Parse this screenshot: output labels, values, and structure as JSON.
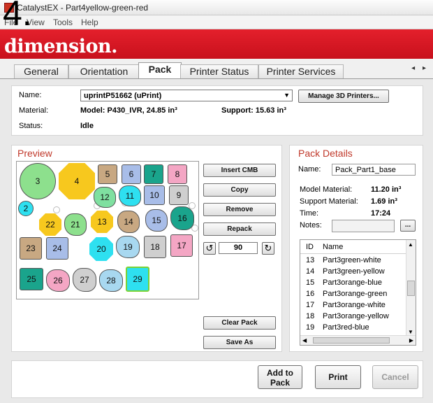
{
  "annotation": {
    "step": "4."
  },
  "window": {
    "title": "CatalystEX - Part4yellow-green-red"
  },
  "menu": [
    "File",
    "View",
    "Tools",
    "Help"
  ],
  "banner": {
    "logo": "dimension."
  },
  "tabs": [
    {
      "label": "General",
      "active": false
    },
    {
      "label": "Orientation",
      "active": false
    },
    {
      "label": "Pack",
      "active": true
    },
    {
      "label": "Printer Status",
      "active": false
    },
    {
      "label": "Printer Services",
      "active": false
    }
  ],
  "tab_arrows": "◂ ▸",
  "printer": {
    "name_label": "Name:",
    "name_value": "uprintP51662  (uPrint)",
    "manage_button": "Manage 3D Printers...",
    "material_label": "Material:",
    "material_value": "Model:  P430_IVR, 24.85 in³",
    "support_value": "Support:  15.63 in³",
    "status_label": "Status:",
    "status_value": "Idle"
  },
  "preview": {
    "title": "Preview",
    "buttons": {
      "insert": "Insert CMB",
      "copy": "Copy",
      "remove": "Remove",
      "repack": "Repack",
      "clear": "Clear Pack",
      "save": "Save As"
    },
    "rotate_ccw_icon": "↺",
    "rotate_cw_icon": "↻",
    "rotation_value": "90",
    "parts": [
      {
        "id": "3",
        "color": "#8de08d"
      },
      {
        "id": "4",
        "color": "#f7c81e"
      },
      {
        "id": "5",
        "color": "#c8a882"
      },
      {
        "id": "6",
        "color": "#a8bde8"
      },
      {
        "id": "7",
        "color": "#1aa48c"
      },
      {
        "id": "8",
        "color": "#f4a6c4"
      },
      {
        "id": "2",
        "color": "#2ee0f0"
      },
      {
        "id": "12",
        "color": "#7fe0a0"
      },
      {
        "id": "11",
        "color": "#2ee0f0"
      },
      {
        "id": "10",
        "color": "#a8bde8"
      },
      {
        "id": "9",
        "color": "#cfcfcf"
      },
      {
        "id": "22",
        "color": "#f7c81e"
      },
      {
        "id": "21",
        "color": "#8de08d"
      },
      {
        "id": "13",
        "color": "#f7c81e"
      },
      {
        "id": "14",
        "color": "#c8a882"
      },
      {
        "id": "15",
        "color": "#a8bde8"
      },
      {
        "id": "16",
        "color": "#1aa48c"
      },
      {
        "id": "23",
        "color": "#c8a882"
      },
      {
        "id": "24",
        "color": "#a8bde8"
      },
      {
        "id": "20",
        "color": "#2ee0f0"
      },
      {
        "id": "19",
        "color": "#a8d8f0"
      },
      {
        "id": "18",
        "color": "#cfcfcf"
      },
      {
        "id": "17",
        "color": "#f4a6c4"
      },
      {
        "id": "25",
        "color": "#1aa48c"
      },
      {
        "id": "26",
        "color": "#f4a6c4"
      },
      {
        "id": "27",
        "color": "#cfcfcf"
      },
      {
        "id": "28",
        "color": "#a8d8f0"
      },
      {
        "id": "29",
        "color": "#2ee0f0"
      }
    ]
  },
  "pack_details": {
    "title": "Pack Details",
    "name_label": "Name:",
    "name_value": "Pack_Part1_base",
    "model_material_label": "Model Material:",
    "model_material_value": "11.20 in³",
    "support_material_label": "Support Material:",
    "support_material_value": "1.69 in³",
    "time_label": "Time:",
    "time_value": "17:24",
    "notes_label": "Notes:",
    "notes_button": "...",
    "list_headers": {
      "id": "ID",
      "name": "Name"
    },
    "list_rows": [
      {
        "id": "13",
        "name": "Part3green-white"
      },
      {
        "id": "14",
        "name": "Part3green-yellow"
      },
      {
        "id": "15",
        "name": "Part3orange-blue"
      },
      {
        "id": "16",
        "name": "Part3orange-green"
      },
      {
        "id": "17",
        "name": "Part3orange-white"
      },
      {
        "id": "18",
        "name": "Part3orange-yellow"
      },
      {
        "id": "19",
        "name": "Part3red-blue"
      }
    ]
  },
  "actions": {
    "add_to_pack": "Add to Pack",
    "print": "Print",
    "cancel": "Cancel"
  }
}
